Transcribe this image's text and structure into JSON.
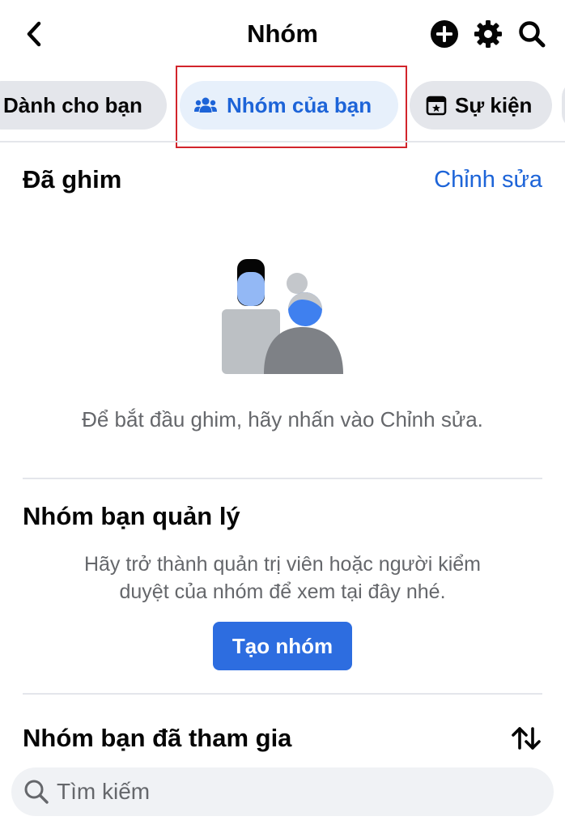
{
  "header": {
    "title": "Nhóm",
    "icons": [
      "back-chevron-icon",
      "plus-circle-icon",
      "gear-icon",
      "search-icon"
    ]
  },
  "tabs": [
    {
      "label": "Dành cho bạn",
      "active": false
    },
    {
      "label": "Nhóm của bạn",
      "active": true,
      "icon": "people-icon"
    },
    {
      "label": "Sự kiện",
      "active": false,
      "icon": "calendar-star-icon"
    }
  ],
  "pinned": {
    "title": "Đã ghim",
    "edit_label": "Chỉnh sửa",
    "empty_text": "Để bắt đầu ghim, hãy nhấn vào Chỉnh sửa."
  },
  "managed": {
    "title": "Nhóm bạn quản lý",
    "description_line1": "Hãy trở thành quản trị viên hoặc người kiểm",
    "description_line2": "duyệt của nhóm để xem tại đây nhé.",
    "create_button": "Tạo nhóm"
  },
  "joined": {
    "title": "Nhóm bạn đã tham gia",
    "sort_icon": "sort-arrows-icon",
    "search_placeholder": "Tìm kiếm"
  },
  "colors": {
    "accent": "#1d64d8",
    "button": "#2d6de0",
    "highlight": "#d2242b",
    "tab_bg": "#e4e6eb",
    "tab_active_bg": "#e7f0fb",
    "muted_text": "#65676b"
  }
}
